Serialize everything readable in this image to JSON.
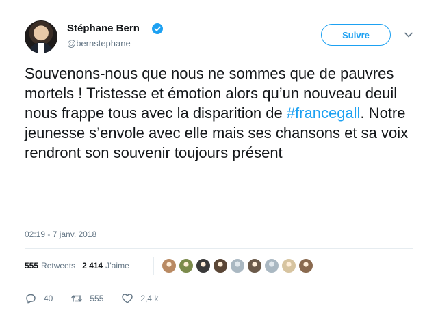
{
  "user": {
    "name": "Stéphane Bern",
    "handle": "@bernstephane",
    "avatar_icon": "profile-photo-avatar",
    "verified_icon": "verified-badge-icon",
    "verified_color": "#1da1f2"
  },
  "follow": {
    "label": "Suivre",
    "color": "#1da1f2"
  },
  "more": {
    "icon": "chevron-down-icon"
  },
  "tweet": {
    "text_before": "Souvenons-nous que nous ne sommes que de pauvres mortels ! Tristesse et émotion alors qu’un nouveau deuil nous frappe tous avec la disparition de ",
    "hashtag": "#francegall",
    "text_after": ". Notre jeunesse s’envole avec elle mais ses chansons et sa voix rendront son souvenir toujours présent",
    "hashtag_color": "#1da1f2"
  },
  "timestamp": "02:19 - 7 janv. 2018",
  "stats": {
    "retweets_count": "555",
    "retweets_label": "Retweets",
    "likes_count": "2 414",
    "likes_label": "J’aime"
  },
  "likers": [
    {
      "icon": "liker-avatar-1",
      "color": "#b98a63"
    },
    {
      "icon": "liker-avatar-2",
      "color": "#7c8b4c"
    },
    {
      "icon": "liker-avatar-3",
      "color": "#3a3a3a"
    },
    {
      "icon": "liker-avatar-4",
      "color": "#5a4636"
    },
    {
      "icon": "liker-avatar-default-egg",
      "color": "#aab8c2"
    },
    {
      "icon": "liker-avatar-5",
      "color": "#6b5a4a"
    },
    {
      "icon": "liker-avatar-default-egg",
      "color": "#aab8c2"
    },
    {
      "icon": "liker-avatar-6",
      "color": "#d7c4a0"
    },
    {
      "icon": "liker-avatar-7",
      "color": "#8a6a4f"
    }
  ],
  "actions": {
    "reply": {
      "icon": "reply-icon",
      "count": "40"
    },
    "retweet": {
      "icon": "retweet-icon",
      "count": "555"
    },
    "like": {
      "icon": "heart-icon",
      "count": "2,4 k"
    }
  }
}
